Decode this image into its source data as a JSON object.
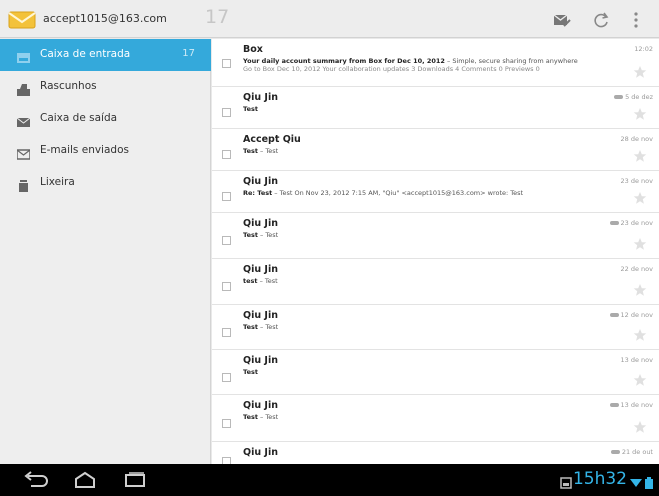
{
  "header": {
    "account": "accept1015@163.com",
    "unread_count": "17"
  },
  "sidebar": {
    "folders": [
      {
        "label": "Caixa de entrada",
        "count": "17",
        "icon": "inbox-icon",
        "selected": true
      },
      {
        "label": "Rascunhos",
        "count": "",
        "icon": "drafts-icon",
        "selected": false
      },
      {
        "label": "Caixa de saída",
        "count": "",
        "icon": "outbox-icon",
        "selected": false
      },
      {
        "label": "E-mails enviados",
        "count": "",
        "icon": "sent-icon",
        "selected": false
      },
      {
        "label": "Lixeira",
        "count": "",
        "icon": "trash-icon",
        "selected": false
      }
    ]
  },
  "messages": [
    {
      "sender": "Box",
      "subject": "Your daily account summary from Box for Dec 10, 2012",
      "snippet": " – Simple, secure sharing from anywhere",
      "line2": "Go to Box Dec 10, 2012 Your collaboration updates 3 Downloads 4 Comments 0 Previews 0",
      "date": "12:02",
      "has_tag": false
    },
    {
      "sender": "Qiu Jin",
      "subject": "Test",
      "snippet": "",
      "line2": "",
      "date": "5 de dez",
      "has_tag": true
    },
    {
      "sender": "Accept Qiu",
      "subject": "Test",
      "snippet": " – Test",
      "line2": "",
      "date": "28 de nov",
      "has_tag": false
    },
    {
      "sender": "Qiu Jin",
      "subject": "Re: Test",
      "snippet": " – Test On Nov 23, 2012 7:15 AM, \"Qiu\" <accept1015@163.com> wrote: Test",
      "line2": "",
      "date": "23 de nov",
      "has_tag": false
    },
    {
      "sender": "Qiu Jin",
      "subject": "Test",
      "snippet": " – Test",
      "line2": "",
      "date": "23 de nov",
      "has_tag": true
    },
    {
      "sender": "Qiu Jin",
      "subject": "test",
      "snippet": " – Test",
      "line2": "",
      "date": "22 de nov",
      "has_tag": false
    },
    {
      "sender": "Qiu Jin",
      "subject": "Test",
      "snippet": " – Test",
      "line2": "",
      "date": "12 de nov",
      "has_tag": true
    },
    {
      "sender": "Qiu Jin",
      "subject": "Test",
      "snippet": "",
      "line2": "",
      "date": "13 de nov",
      "has_tag": false
    },
    {
      "sender": "Qiu Jin",
      "subject": "Test",
      "snippet": " – Test",
      "line2": "",
      "date": "13 de nov",
      "has_tag": true
    },
    {
      "sender": "Qiu Jin",
      "subject": "",
      "snippet": "",
      "line2": "",
      "date": "21 de out",
      "has_tag": true
    }
  ],
  "status_bar": {
    "time": "15h32"
  },
  "colors": {
    "accent": "#34a9db",
    "clock": "#34b5e8"
  }
}
